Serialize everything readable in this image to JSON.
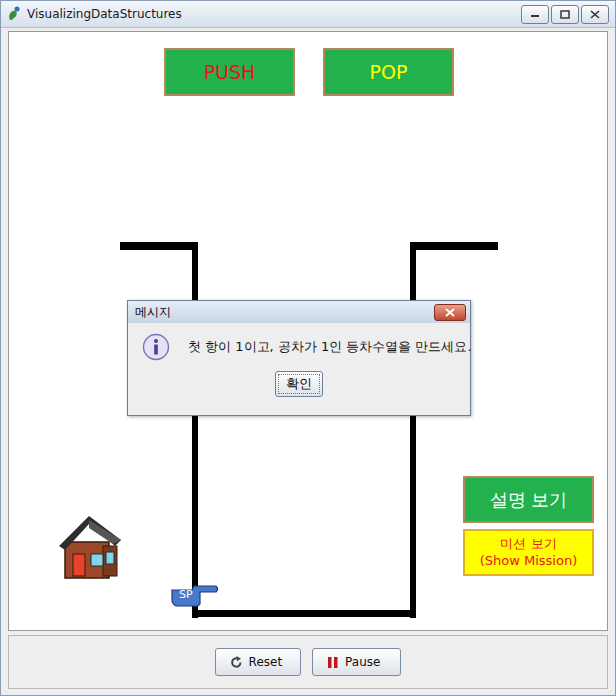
{
  "window": {
    "title": "VisualizingDataStructures"
  },
  "canvas": {
    "top_buttons": [
      {
        "label": "PUSH",
        "color": "#e8141c"
      },
      {
        "label": "POP",
        "color": "#ffff00"
      }
    ],
    "stack_pointer": "SP",
    "side_buttons": [
      {
        "kind": "help",
        "lines": [
          "설명 보기"
        ]
      },
      {
        "kind": "mission",
        "lines": [
          "미션 보기",
          "(Show Mission)"
        ]
      }
    ]
  },
  "dialog": {
    "title": "메시지",
    "message": "첫 항이 1이고, 공차가 1인 등차수열을 만드세요.",
    "button": "확인"
  },
  "controls": [
    {
      "kind": "reset",
      "label": "Reset"
    },
    {
      "kind": "pause",
      "label": "Pause"
    }
  ]
}
